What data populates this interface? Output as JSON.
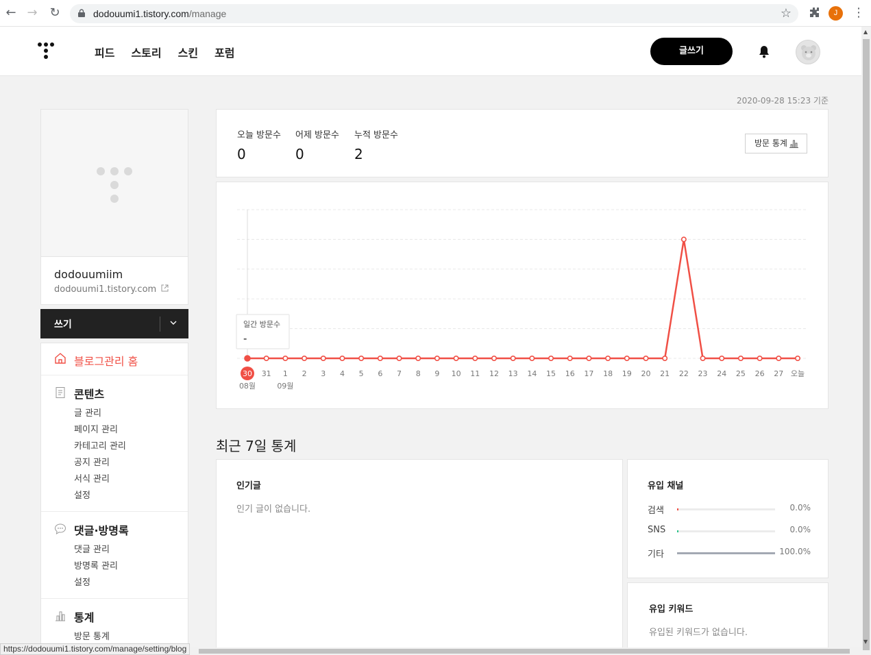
{
  "browser": {
    "url_host": "dodouumi1.tistory.com",
    "url_path": "/manage",
    "profile_initial": "J",
    "status_url": "https://dodouumi1.tistory.com/manage/setting/blog"
  },
  "header": {
    "nav": [
      "피드",
      "스토리",
      "스킨",
      "포럼"
    ],
    "write_label": "글쓰기"
  },
  "sidebar": {
    "blog_name": "dodouumiim",
    "blog_url": "dodouumi1.tistory.com",
    "write_label": "쓰기",
    "home_label": "블로그관리 홈",
    "sections": [
      {
        "title": "콘텐츠",
        "items": [
          "글 관리",
          "페이지 관리",
          "카테고리 관리",
          "공지 관리",
          "서식 관리",
          "설정"
        ]
      },
      {
        "title": "댓글·방명록",
        "items": [
          "댓글 관리",
          "방명록 관리",
          "설정"
        ]
      },
      {
        "title": "통계",
        "items": [
          "방문 통계"
        ]
      }
    ]
  },
  "main": {
    "updated_at": "2020-09-28 15:23 기준",
    "stats": [
      {
        "label": "오늘 방문수",
        "value": "0"
      },
      {
        "label": "어제 방문수",
        "value": "0"
      },
      {
        "label": "누적 방문수",
        "value": "2"
      }
    ],
    "stats_button": "방문 통계",
    "recent_title": "최근 7일 통계",
    "popular": {
      "title": "인기글",
      "empty": "인기 글이 없습니다."
    },
    "channels": {
      "title": "유입 채널",
      "rows": [
        {
          "name": "검색",
          "value": 0.0,
          "label": "0.0%",
          "color": "#f04f45"
        },
        {
          "name": "SNS",
          "value": 0.0,
          "label": "0.0%",
          "color": "#2bc48a"
        },
        {
          "name": "기타",
          "value": 100.0,
          "label": "100.0%",
          "color": "#a3a8b3"
        }
      ]
    },
    "keywords": {
      "title": "유입 키워드",
      "empty": "유입된 키워드가 없습니다."
    }
  },
  "chart_data": {
    "type": "line",
    "x": [
      "30",
      "31",
      "1",
      "2",
      "3",
      "4",
      "5",
      "6",
      "7",
      "8",
      "9",
      "10",
      "11",
      "12",
      "13",
      "14",
      "15",
      "16",
      "17",
      "18",
      "19",
      "20",
      "21",
      "22",
      "23",
      "24",
      "25",
      "26",
      "27",
      "오늘"
    ],
    "month_labels": [
      {
        "label": "08월",
        "at": "30"
      },
      {
        "label": "09월",
        "at": "1"
      }
    ],
    "series": [
      {
        "values": [
          0,
          0,
          0,
          0,
          0,
          0,
          0,
          0,
          0,
          0,
          0,
          0,
          0,
          0,
          0,
          0,
          0,
          0,
          0,
          0,
          0,
          0,
          0,
          2,
          0,
          0,
          0,
          0,
          0,
          0
        ],
        "color": "#f04f45"
      }
    ],
    "ylim": [
      0,
      2.5
    ],
    "grid": true,
    "selected_index": 0,
    "tooltip": {
      "title": "일간 방문수",
      "value": "-"
    }
  }
}
